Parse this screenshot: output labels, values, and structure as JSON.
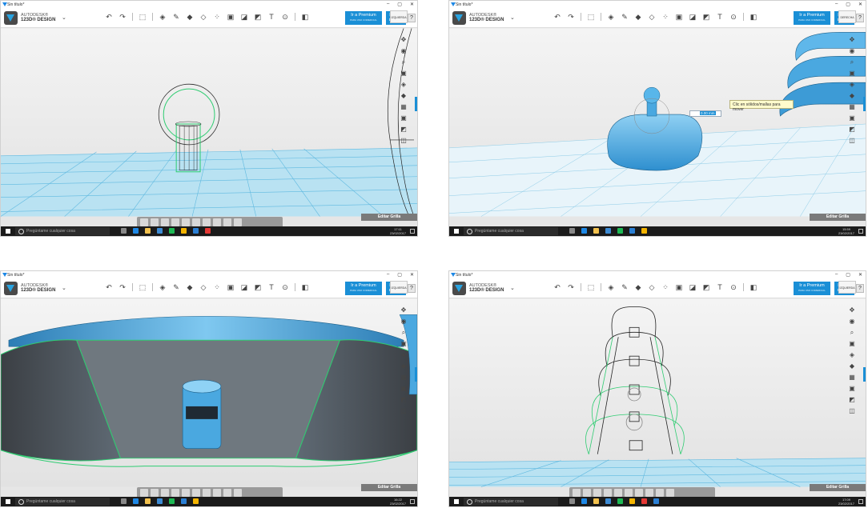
{
  "shots": [
    {
      "window_title": "Sin título*",
      "app": {
        "name_line1": "AUTODESK®",
        "name_line2": "123D® DESIGN"
      },
      "buttons": {
        "premium": "Ir a Premium",
        "premium_sub": "PARA USO COMERCIAL",
        "login_l1": "Iniciar",
        "login_l2": "sesión",
        "help": "?"
      },
      "navcube_label": "IZQUIERDA",
      "edit_grid": "Editar Grilla",
      "taskbar": {
        "search": "Pregúntame cualquier cosa",
        "time": "17:11",
        "date": "23/02/2017"
      }
    },
    {
      "window_title": "Sin título*",
      "app": {
        "name_line1": "AUTODESK®",
        "name_line2": "123D® DESIGN"
      },
      "buttons": {
        "premium": "Ir a Premium",
        "premium_sub": "PARA USO COMERCIAL",
        "login_l1": "Iniciar",
        "login_l2": "sesión",
        "help": "?"
      },
      "navcube_label": "DERECHA",
      "edit_grid": "Editar Grilla",
      "tooltip": "Clic en sólidos/mallas para mover",
      "dim_value": "0.00 mm",
      "taskbar": {
        "search": "Pregúntame cualquier cosa",
        "time": "15:59",
        "date": "23/02/2017"
      }
    },
    {
      "window_title": "Sin título*",
      "app": {
        "name_line1": "AUTODESK®",
        "name_line2": "123D® DESIGN"
      },
      "buttons": {
        "premium": "Ir a Premium",
        "premium_sub": "PARA USO COMERCIAL",
        "login_l1": "Iniciar",
        "login_l2": "sesión",
        "help": "?"
      },
      "navcube_label": "IZQUIERDA",
      "edit_grid": "Editar Grilla",
      "taskbar": {
        "search": "Pregúntame cualquier cosa",
        "time": "16:22",
        "date": "23/02/2017"
      }
    },
    {
      "window_title": "Sin título*",
      "app": {
        "name_line1": "AUTODESK®",
        "name_line2": "123D® DESIGN"
      },
      "buttons": {
        "premium": "Ir a Premium",
        "premium_sub": "PARA USO COMERCIAL",
        "login_l1": "Iniciar",
        "login_l2": "sesión",
        "help": "?"
      },
      "navcube_label": "IZQUIERDA",
      "edit_grid": "Editar Grilla",
      "taskbar": {
        "search": "Pregúntame cualquier cosa",
        "time": "17:09",
        "date": "23/02/2017"
      }
    }
  ],
  "colors": {
    "accent": "#1a8fd6",
    "model_blue": "#3fa2dc",
    "grid": "#5fb9e0",
    "edge_green": "#2ecc71"
  }
}
